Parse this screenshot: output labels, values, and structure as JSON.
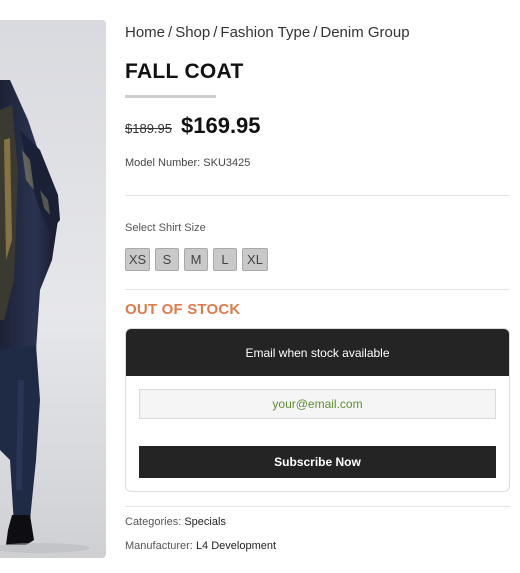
{
  "product": {
    "image_alt": "Model wearing a dark denim fall coat",
    "breadcrumb": [
      "Home",
      "Shop",
      "Fashion Type",
      "Denim Group"
    ],
    "breadcrumb_separator": "/",
    "title": "FALL COAT",
    "old_price": "$189.95",
    "price": "$169.95",
    "model_label": "Model Number:",
    "model_value": "SKU3425",
    "size_label": "Select Shirt Size",
    "sizes": [
      "XS",
      "S",
      "M",
      "L",
      "XL"
    ],
    "stock_status": "OUT OF STOCK",
    "notify": {
      "header": "Email when stock available",
      "email_placeholder": "your@email.com",
      "button": "Subscribe Now"
    },
    "categories_label": "Categories:",
    "categories_value": "Specials",
    "manufacturer_label": "Manufacturer:",
    "manufacturer_value": "L4 Development"
  },
  "colors": {
    "accent": "#e07a4a",
    "dark": "#242424",
    "email_text": "#5e8e34"
  }
}
